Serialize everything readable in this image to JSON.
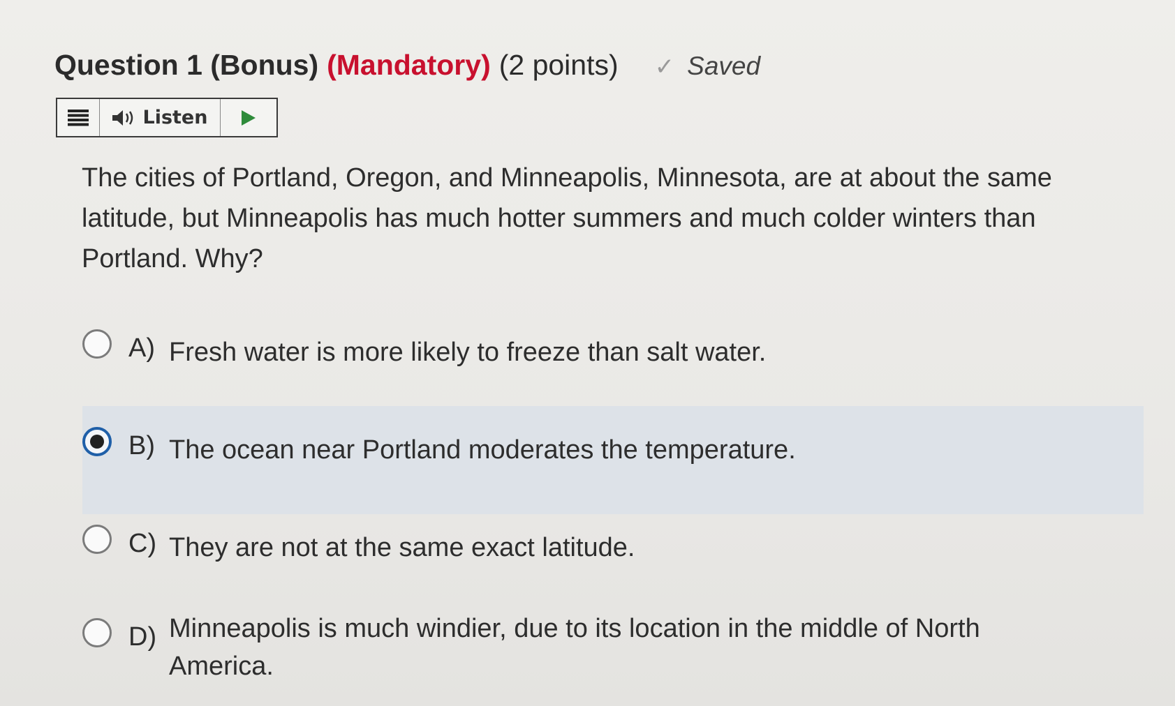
{
  "question": {
    "title": "Question 1 (Bonus)",
    "mandatory": "(Mandatory)",
    "points": "(2 points)",
    "status": "Saved"
  },
  "toolbar": {
    "listen_label": "Listen"
  },
  "prompt": "The cities of Portland, Oregon, and Minneapolis, Minnesota, are at about the same latitude, but Minneapolis has much hotter summers and much colder winters than Portland. Why?",
  "options": [
    {
      "letter": "A)",
      "text": "Fresh water is more likely to freeze than salt water.",
      "selected": false
    },
    {
      "letter": "B)",
      "text": "The ocean near Portland moderates the temperature.",
      "selected": true
    },
    {
      "letter": "C)",
      "text": "They are not at the same exact latitude.",
      "selected": false
    },
    {
      "letter": "D)",
      "text": "Minneapolis is much windier, due to its location in the middle of North America.",
      "selected": false
    }
  ],
  "colors": {
    "mandatory_red": "#c8102e",
    "selected_blue": "#1f5fa8",
    "selected_band": "#dde2e8"
  }
}
